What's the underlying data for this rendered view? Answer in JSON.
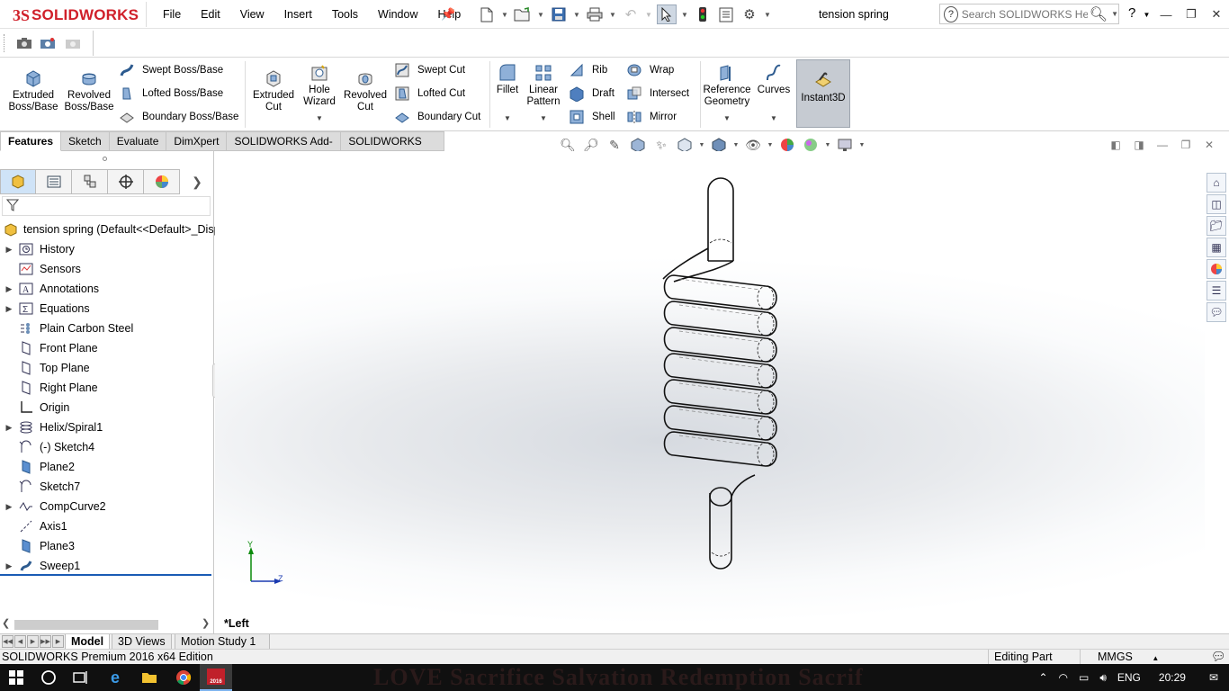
{
  "app": {
    "brand_prefix": "3S",
    "brand_name": "SOLIDWORKS",
    "document_title": "tension spring"
  },
  "menubar": {
    "items": [
      "File",
      "Edit",
      "View",
      "Insert",
      "Tools",
      "Window",
      "Help"
    ]
  },
  "search": {
    "placeholder": "Search SOLIDWORKS Help"
  },
  "help_label": "?",
  "command_manager": {
    "extruded_boss": "Extruded\nBoss/Base",
    "revolved_boss": "Revolved\nBoss/Base",
    "swept_boss": "Swept Boss/Base",
    "lofted_boss": "Lofted Boss/Base",
    "boundary_boss": "Boundary Boss/Base",
    "extruded_cut": "Extruded\nCut",
    "hole_wizard": "Hole\nWizard",
    "revolved_cut": "Revolved\nCut",
    "swept_cut": "Swept Cut",
    "lofted_cut": "Lofted Cut",
    "boundary_cut": "Boundary Cut",
    "fillet": "Fillet",
    "linear_pattern": "Linear\nPattern",
    "rib": "Rib",
    "draft": "Draft",
    "shell": "Shell",
    "wrap": "Wrap",
    "intersect": "Intersect",
    "mirror": "Mirror",
    "reference_geometry": "Reference\nGeometry",
    "curves": "Curves",
    "instant3d": "Instant3D"
  },
  "cm_tabs": [
    "Features",
    "Sketch",
    "Evaluate",
    "DimXpert",
    "SOLIDWORKS Add-Ins",
    "SOLIDWORKS MBD"
  ],
  "tree": {
    "root": "tension spring  (Default<<Default>_Disp",
    "items": [
      {
        "label": "History",
        "expandable": true,
        "icon": "history-icon"
      },
      {
        "label": "Sensors",
        "expandable": false,
        "icon": "sensors-icon"
      },
      {
        "label": "Annotations",
        "expandable": true,
        "icon": "annotations-icon"
      },
      {
        "label": "Equations",
        "expandable": true,
        "icon": "equations-icon"
      },
      {
        "label": "Plain Carbon Steel",
        "expandable": false,
        "icon": "material-icon"
      },
      {
        "label": "Front Plane",
        "expandable": false,
        "icon": "plane-icon"
      },
      {
        "label": "Top Plane",
        "expandable": false,
        "icon": "plane-icon"
      },
      {
        "label": "Right Plane",
        "expandable": false,
        "icon": "plane-icon"
      },
      {
        "label": "Origin",
        "expandable": false,
        "icon": "origin-icon"
      },
      {
        "label": "Helix/Spiral1",
        "expandable": true,
        "icon": "helix-icon"
      },
      {
        "label": "(-) Sketch4",
        "expandable": false,
        "icon": "sketch-icon"
      },
      {
        "label": "Plane2",
        "expandable": false,
        "icon": "ref-plane-icon"
      },
      {
        "label": "Sketch7",
        "expandable": false,
        "icon": "sketch-icon"
      },
      {
        "label": "CompCurve2",
        "expandable": true,
        "icon": "composite-curve-icon"
      },
      {
        "label": "Axis1",
        "expandable": false,
        "icon": "axis-icon"
      },
      {
        "label": "Plane3",
        "expandable": false,
        "icon": "ref-plane-icon"
      },
      {
        "label": "Sweep1",
        "expandable": true,
        "icon": "sweep-icon"
      }
    ]
  },
  "viewport": {
    "view_label": "*Left",
    "triad_y": "Y",
    "triad_z": "Z"
  },
  "bottom_tabs": [
    "Model",
    "3D Views",
    "Motion Study 1"
  ],
  "statusbar": {
    "edition": "SOLIDWORKS Premium 2016 x64 Edition",
    "mode": "Editing Part",
    "units": "MMGS"
  },
  "taskbar": {
    "wallpaper_text": "LOVE  Sacrifice  Salvation  Redemption  Sacrifice",
    "language": "ENG",
    "time": "20:29",
    "sw_badge": "2016"
  },
  "colors": {
    "brand": "#d0202a",
    "accent": "#1a5bb5",
    "instant3d_bg": "#c6cbd2"
  }
}
